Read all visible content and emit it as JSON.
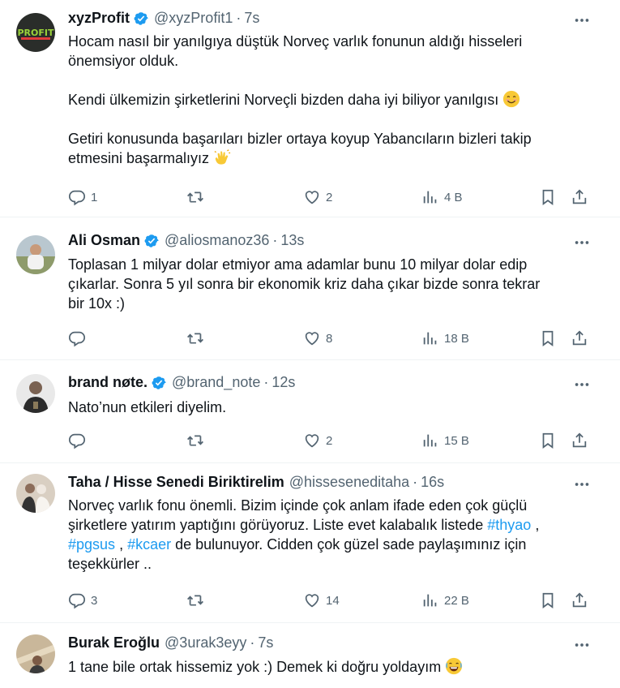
{
  "tweets": [
    {
      "name": "xyzProfit",
      "handle": "@xyzProfit1",
      "time": "7s",
      "avatar_text": "PROFIT",
      "lines": [
        "Hocam nasıl bir yanılgıya düştük Norveç varlık fonunun aldığı hisseleri",
        "önemsiyor olduk.",
        "Kendi ülkemizin şirketlerini Norveçli bizden daha iyi biliyor yanılgısı",
        "Getiri konusunda başarıları bizler ortaya koyup Yabancıların bizleri takip",
        "etmesini başarmalıyız"
      ],
      "replies": "1",
      "retweets": "",
      "likes": "2",
      "views": "4 B"
    },
    {
      "name": "Ali Osman",
      "handle": "@aliosmanoz36",
      "time": "13s",
      "lines": [
        "Toplasan 1 milyar dolar etmiyor ama adamlar bunu 10 milyar dolar edip",
        "çıkarlar. Sonra 5 yıl sonra bir  ekonomik kriz daha çıkar bizde sonra tekrar",
        "bir 10x :)"
      ],
      "replies": "",
      "retweets": "",
      "likes": "8",
      "views": "18 B"
    },
    {
      "name": "brand nøte.",
      "handle": "@brand_note",
      "time": "12s",
      "lines": [
        "Nato’nun etkileri diyelim."
      ],
      "replies": "",
      "retweets": "",
      "likes": "2",
      "views": "15 B"
    },
    {
      "name": "Taha / Hisse Senedi Biriktirelim",
      "handle": "@hisseseneditaha",
      "time": "16s",
      "lines": [
        "Norveç varlık fonu önemli. Bizim içinde çok anlam ifade eden çok güçlü",
        "şirketlere yatırım yaptığını görüyoruz. Liste evet kalabalık listede",
        "de bulunuyor. Cidden çok güzel sade paylaşımınız için",
        "teşekkürler .."
      ],
      "hashtags": [
        "#thyao",
        "#pgsus",
        "#kcaer"
      ],
      "hashtag_sep": ",",
      "replies": "3",
      "retweets": "",
      "likes": "14",
      "views": "22 B"
    },
    {
      "name": "Burak Eroğlu",
      "handle": "@3urak3eyy",
      "time": "7s",
      "lines": [
        "1 tane bile ortak hissemiz yok :) Demek ki doğru yoldayım"
      ]
    }
  ],
  "colors": {
    "text": "#0f1419",
    "muted": "#536471",
    "accent": "#1d9bf0",
    "divider": "#eff3f4"
  },
  "icons": [
    "verified-badge-icon",
    "more-icon",
    "reply-icon",
    "retweet-icon",
    "like-icon",
    "views-icon",
    "bookmark-icon",
    "share-icon"
  ]
}
